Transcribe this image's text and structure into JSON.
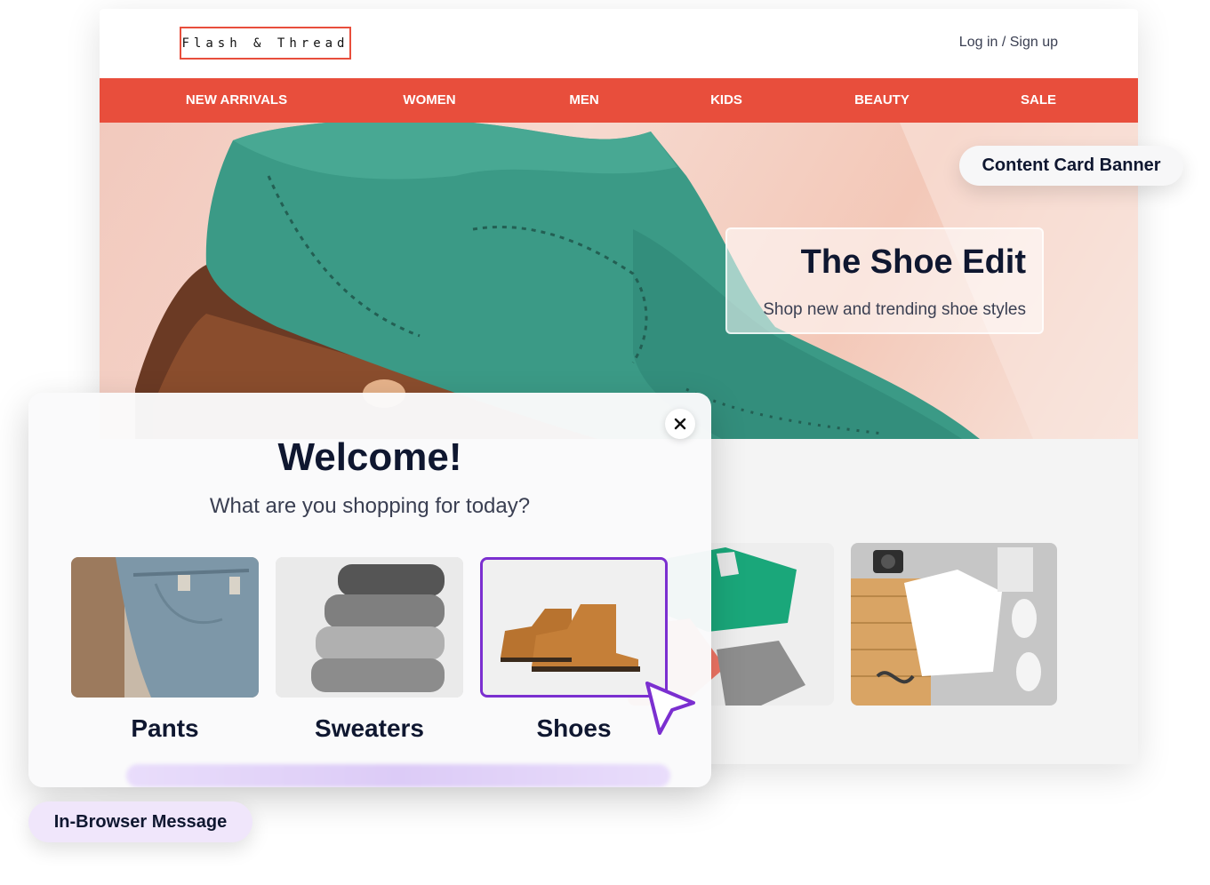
{
  "site": {
    "logo": "Flash & Thread",
    "login": "Log in / Sign up",
    "nav": [
      "NEW ARRIVALS",
      "WOMEN",
      "MEN",
      "KIDS",
      "BEAUTY",
      "SALE"
    ],
    "hero": {
      "title": "The Shoe Edit",
      "subtitle": "Shop new and trending shoe styles"
    },
    "accent_color": "#e84e3c"
  },
  "callouts": {
    "content_card": "Content Card Banner",
    "in_browser": "In-Browser Message"
  },
  "modal": {
    "title": "Welcome!",
    "subtitle": "What are you shopping for today?",
    "options": [
      {
        "label": "Pants",
        "selected": false
      },
      {
        "label": "Sweaters",
        "selected": false
      },
      {
        "label": "Shoes",
        "selected": true
      }
    ],
    "selection_color": "#7b2fd0"
  }
}
